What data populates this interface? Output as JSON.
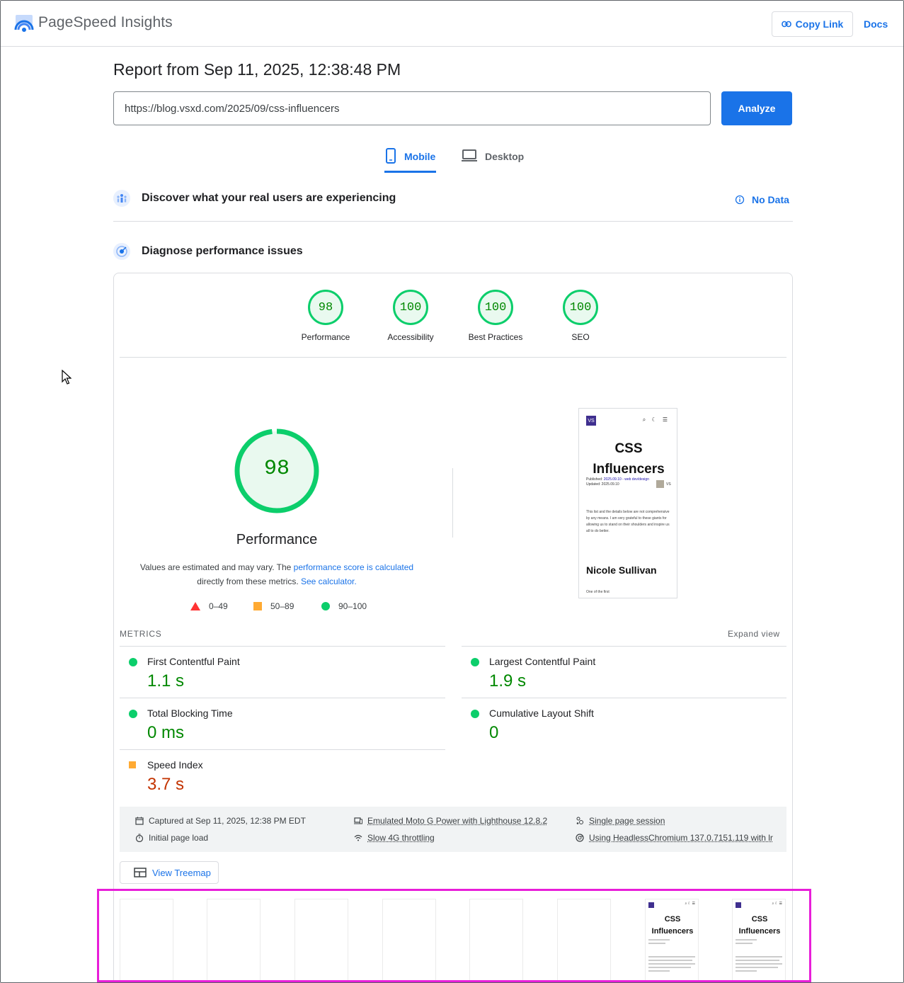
{
  "header": {
    "brand": "PageSpeed Insights",
    "copy_link": "Copy Link",
    "docs": "Docs"
  },
  "report": {
    "title": "Report from Sep 11, 2025, 12:38:48 PM",
    "url": "https://blog.vsxd.com/2025/09/css-influencers",
    "analyze": "Analyze"
  },
  "tabs": {
    "mobile": "Mobile",
    "desktop": "Desktop"
  },
  "sections": {
    "real_users": "Discover what your real users are experiencing",
    "no_data": "No Data",
    "diagnose": "Diagnose performance issues"
  },
  "scores": [
    {
      "value": "98",
      "label": "Performance"
    },
    {
      "value": "100",
      "label": "Accessibility"
    },
    {
      "value": "100",
      "label": "Best Practices"
    },
    {
      "value": "100",
      "label": "SEO"
    }
  ],
  "performance": {
    "score": "98",
    "score_fraction": 0.98,
    "title": "Performance",
    "desc_prefix": "Values are estimated and may vary. The ",
    "desc_link1": "performance score is calculated",
    "desc_middle": " directly from these metrics. ",
    "desc_link2": "See calculator.",
    "legend": [
      "0–49",
      "50–89",
      "90–100"
    ]
  },
  "screenshot": {
    "logo": "VS",
    "icons": "⌕ ☾ ☰",
    "title": "CSS Influencers",
    "published_label": "Published: ",
    "published_date": "2025.09.10",
    "category": " - web dev/design",
    "updated": "Updated: 2025.09.10",
    "author_initials": "VS",
    "body": "This list and the details below are not comprehensive by any means. I am very grateful to these giants for allowing us to stand on their shoulders and inspire us all to do better.",
    "heading": "Nicole Sullivan",
    "footer": "One of the first"
  },
  "metrics": {
    "label": "METRICS",
    "expand": "Expand view",
    "items": [
      {
        "name": "First Contentful Paint",
        "value": "1.1 s",
        "rating": "good"
      },
      {
        "name": "Largest Contentful Paint",
        "value": "1.9 s",
        "rating": "good"
      },
      {
        "name": "Total Blocking Time",
        "value": "0 ms",
        "rating": "good"
      },
      {
        "name": "Cumulative Layout Shift",
        "value": "0",
        "rating": "good"
      },
      {
        "name": "Speed Index",
        "value": "3.7 s",
        "rating": "average"
      }
    ]
  },
  "run_info": {
    "captured": "Captured at Sep 11, 2025, 12:38 PM EDT",
    "initial_load": "Initial page load",
    "emulated": "Emulated Moto G Power with Lighthouse 12.8.2",
    "throttling": "Slow 4G throttling",
    "session": "Single page session",
    "browser": "Using HeadlessChromium 137.0.7151.119 with lr"
  },
  "treemap": "View Treemap",
  "filmstrip": {
    "frame_title": "CSS Influencers",
    "frame_count": 8
  },
  "colors": {
    "accent": "#1a73e8",
    "good": "#0cce6b",
    "good_text": "#008800",
    "average": "#ffaa33",
    "average_text": "#c33300",
    "poor": "#ff3333",
    "highlight": "#e81ed9"
  }
}
